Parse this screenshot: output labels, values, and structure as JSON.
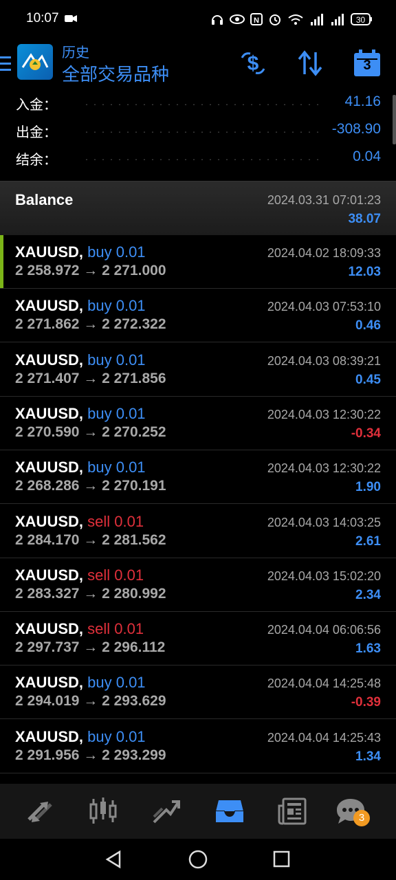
{
  "status": {
    "time": "10:07",
    "battery": "30"
  },
  "header": {
    "title": "历史",
    "subtitle": "全部交易品种",
    "calendar_day": "3"
  },
  "summary": [
    {
      "label": "入金：",
      "value": "41.16"
    },
    {
      "label": "出金：",
      "value": "-308.90"
    },
    {
      "label": "结余：",
      "value": "0.04"
    }
  ],
  "balance": {
    "title": "Balance",
    "time": "2024.03.31 07:01:23",
    "value": "38.07"
  },
  "deals": [
    {
      "symbol": "XAUUSD,",
      "side": "buy 0.01",
      "type": "buy",
      "prices": "2 258.972 → 2 271.000",
      "time": "2024.04.02 18:09:33",
      "profit": "12.03"
    },
    {
      "symbol": "XAUUSD,",
      "side": "buy 0.01",
      "type": "buy",
      "prices": "2 271.862 → 2 272.322",
      "time": "2024.04.03 07:53:10",
      "profit": "0.46"
    },
    {
      "symbol": "XAUUSD,",
      "side": "buy 0.01",
      "type": "buy",
      "prices": "2 271.407 → 2 271.856",
      "time": "2024.04.03 08:39:21",
      "profit": "0.45"
    },
    {
      "symbol": "XAUUSD,",
      "side": "buy 0.01",
      "type": "buy",
      "prices": "2 270.590 → 2 270.252",
      "time": "2024.04.03 12:30:22",
      "profit": "-0.34"
    },
    {
      "symbol": "XAUUSD,",
      "side": "buy 0.01",
      "type": "buy",
      "prices": "2 268.286 → 2 270.191",
      "time": "2024.04.03 12:30:22",
      "profit": "1.90"
    },
    {
      "symbol": "XAUUSD,",
      "side": "sell 0.01",
      "type": "sell",
      "prices": "2 284.170 → 2 281.562",
      "time": "2024.04.03 14:03:25",
      "profit": "2.61"
    },
    {
      "symbol": "XAUUSD,",
      "side": "sell 0.01",
      "type": "sell",
      "prices": "2 283.327 → 2 280.992",
      "time": "2024.04.03 15:02:20",
      "profit": "2.34"
    },
    {
      "symbol": "XAUUSD,",
      "side": "sell 0.01",
      "type": "sell",
      "prices": "2 297.737 → 2 296.112",
      "time": "2024.04.04 06:06:56",
      "profit": "1.63"
    },
    {
      "symbol": "XAUUSD,",
      "side": "buy 0.01",
      "type": "buy",
      "prices": "2 294.019 → 2 293.629",
      "time": "2024.04.04 14:25:48",
      "profit": "-0.39"
    },
    {
      "symbol": "XAUUSD,",
      "side": "buy 0.01",
      "type": "buy",
      "prices": "2 291.956 → 2 293.299",
      "time": "2024.04.04 14:25:43",
      "profit": "1.34"
    }
  ],
  "bottom_nav": {
    "chat_badge": "3"
  },
  "colors": {
    "accent_blue": "#3d8ef5",
    "loss_red": "#e0303b",
    "buy_blue": "#3d8ef5",
    "sell_red": "#e0303b"
  }
}
